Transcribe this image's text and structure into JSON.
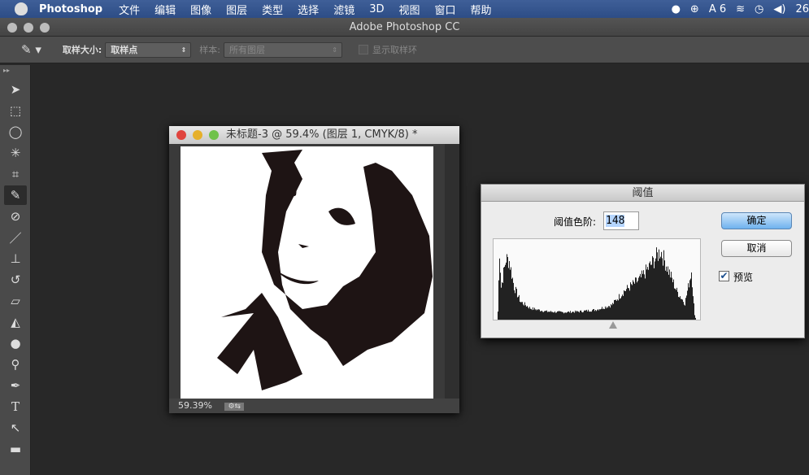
{
  "menubar": {
    "app": "Photoshop",
    "items": [
      "文件",
      "编辑",
      "图像",
      "图层",
      "类型",
      "选择",
      "滤镜",
      "3D",
      "视图",
      "窗口",
      "帮助"
    ],
    "status": {
      "adobe_count": "6",
      "clock": "26"
    }
  },
  "window": {
    "title": "Adobe Photoshop CC"
  },
  "options": {
    "sample_size_label": "取样大小:",
    "sample_size_value": "取样点",
    "sample_label": "样本:",
    "sample_value": "所有图层",
    "show_ring_label": "显示取样环"
  },
  "toolbar": {
    "tools": [
      "move",
      "marquee",
      "lasso",
      "magic-wand",
      "crop",
      "eyedropper",
      "healing-brush",
      "brush",
      "clone-stamp",
      "history-brush",
      "eraser",
      "paint-bucket",
      "blur",
      "dodge",
      "pen",
      "type",
      "path-selection",
      "rectangle"
    ],
    "active": "eyedropper"
  },
  "document": {
    "title": "未标题-3 @ 59.4% (图层 1, CMYK/8) *",
    "zoom": "59.39%"
  },
  "dialog": {
    "title": "阈值",
    "level_label": "阈值色阶:",
    "level_value": "148",
    "ok": "确定",
    "cancel": "取消",
    "preview_label": "预览",
    "preview_checked": true
  }
}
